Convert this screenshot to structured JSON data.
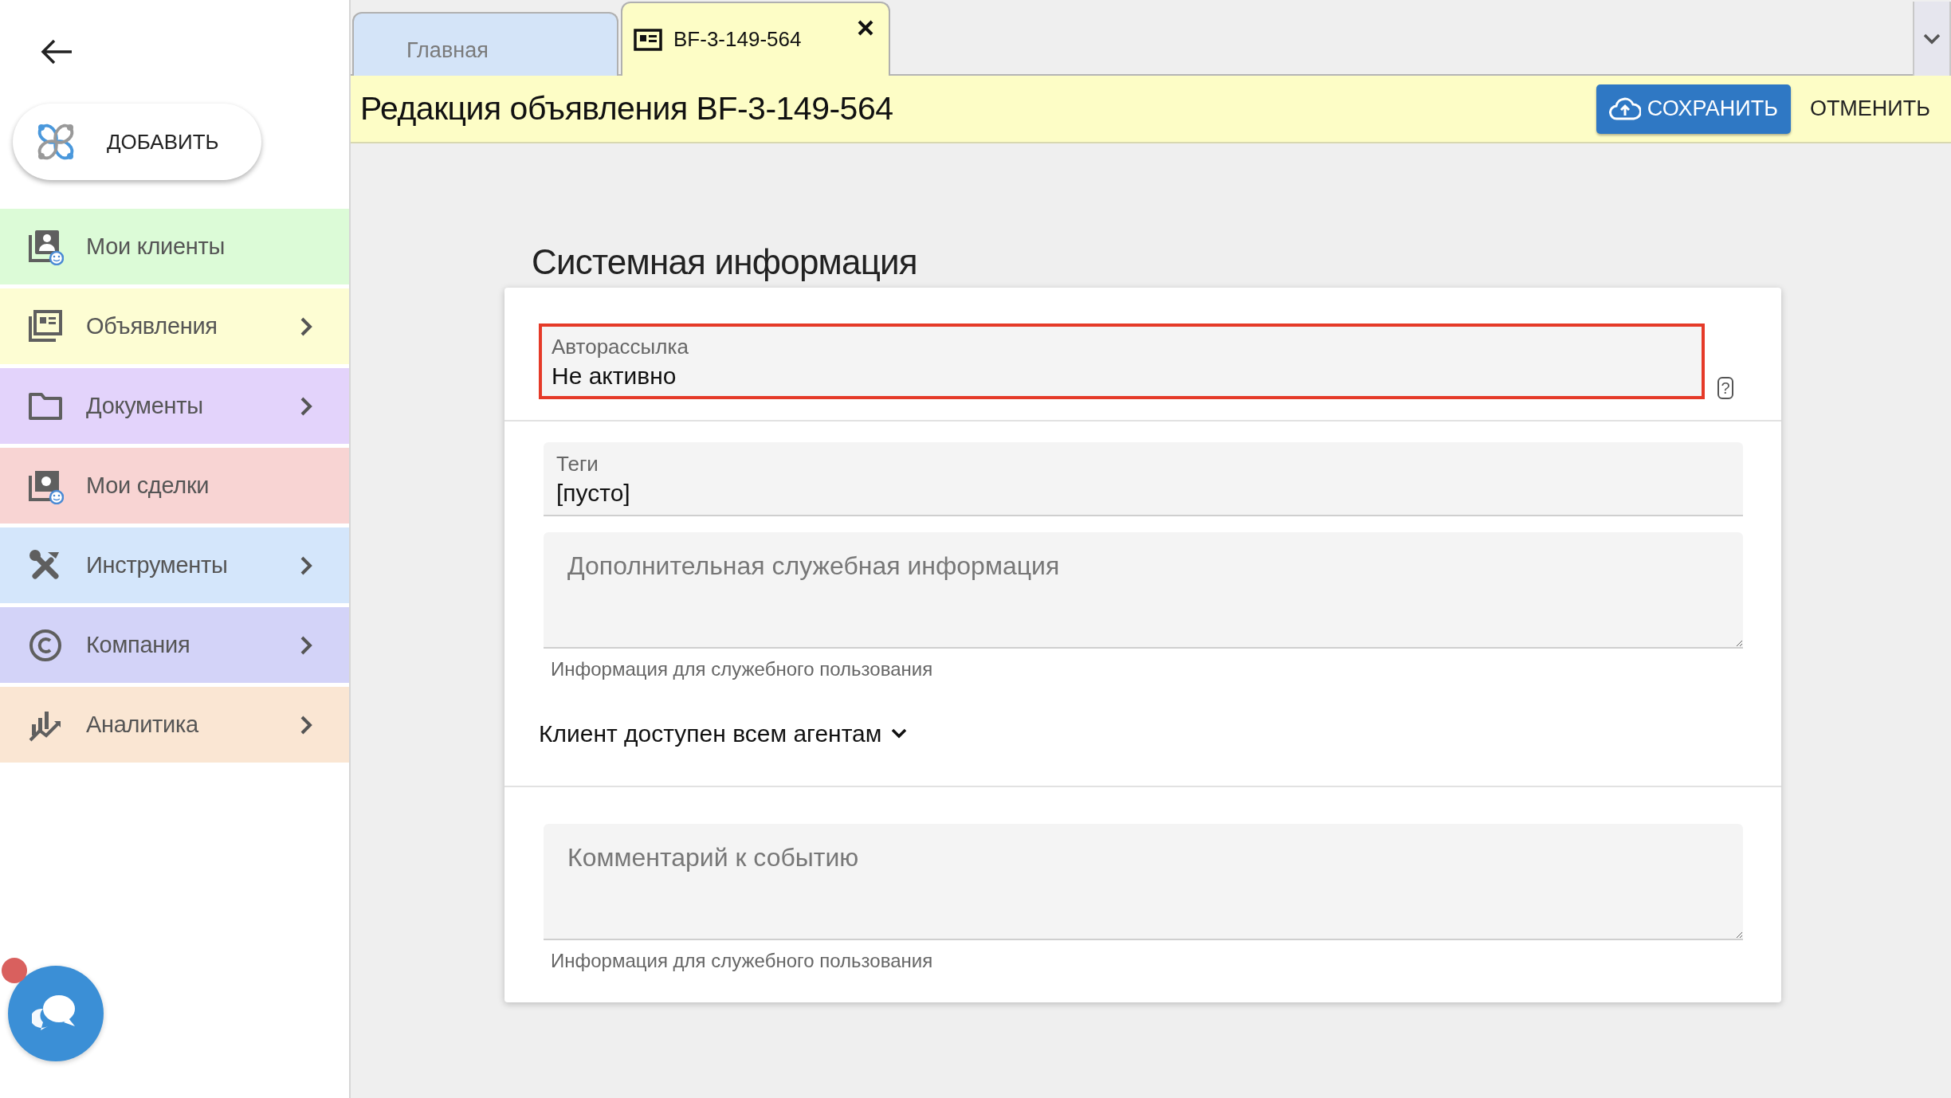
{
  "add_button": {
    "label": "ДОБАВИТЬ"
  },
  "sidebar": {
    "items": [
      {
        "kind": "clients",
        "label": "Мои клиенты",
        "color": "#dcfbd7",
        "expandable": false
      },
      {
        "kind": "listings",
        "label": "Объявления",
        "color": "#fdfdd3",
        "expandable": true
      },
      {
        "kind": "documents",
        "label": "Документы",
        "color": "#e3d3fb",
        "expandable": true
      },
      {
        "kind": "deals",
        "label": "Мои сделки",
        "color": "#f8d4d3",
        "expandable": false
      },
      {
        "kind": "tools",
        "label": "Инструменты",
        "color": "#d4e6fb",
        "expandable": true
      },
      {
        "kind": "company",
        "label": "Компания",
        "color": "#d3d3f8",
        "expandable": true
      },
      {
        "kind": "analytics",
        "label": "Аналитика",
        "color": "#fae6d3",
        "expandable": true
      }
    ]
  },
  "tabs": [
    {
      "kind": "plain",
      "label": "Главная",
      "selected": false,
      "closable": false
    },
    {
      "kind": "document",
      "label": "BF-3-149-564",
      "selected": true,
      "closable": true
    }
  ],
  "header": {
    "title": "Редакция объявления BF-3-149-564",
    "save_label": "СОХРАНИТЬ",
    "cancel_label": "ОТМЕНИТЬ"
  },
  "section_title": "Системная информация",
  "field_groups": [
    {
      "fields": [
        {
          "kind": "select",
          "label": "Авторассылка",
          "value": "Не активно",
          "highlighted": true,
          "help": "?"
        }
      ]
    },
    {
      "fields": [
        {
          "kind": "select",
          "label": "Теги",
          "value": "[пусто]",
          "highlighted": false
        },
        {
          "kind": "textarea",
          "placeholder": "Дополнительная служебная информация",
          "helper": "Информация для служебного пользования"
        },
        {
          "kind": "dropdown",
          "label": "Клиент доступен всем агентам",
          "expanded": false
        }
      ]
    },
    {
      "fields": [
        {
          "kind": "textarea",
          "placeholder": "Комментарий к событию",
          "helper": "Информация для служебного пользования"
        }
      ]
    }
  ],
  "chat": {
    "unread": true
  }
}
